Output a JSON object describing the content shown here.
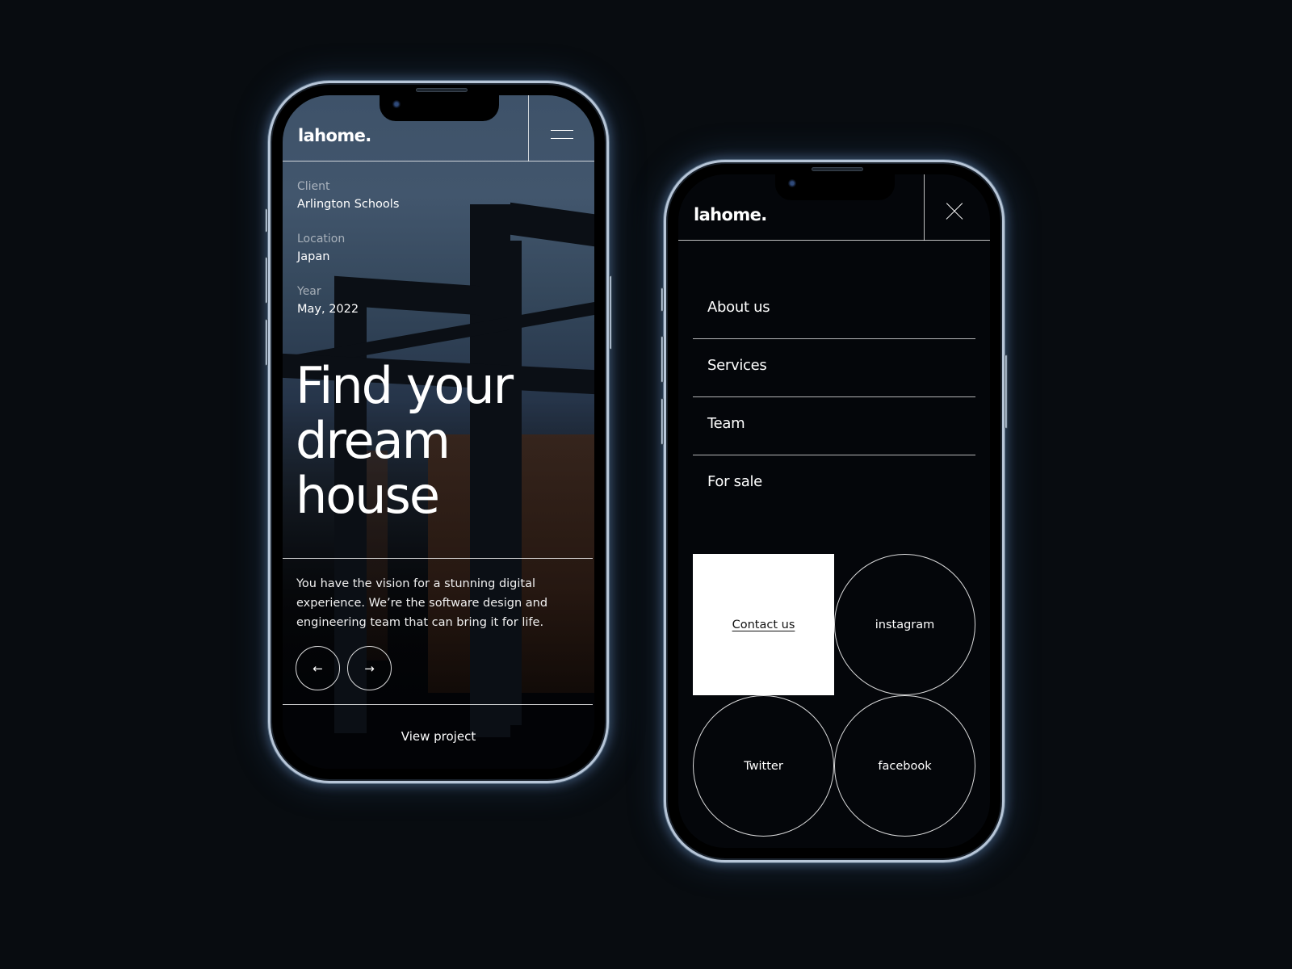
{
  "left_phone": {
    "brand": "lahome.",
    "menu_icon": "hamburger-menu-icon",
    "meta": [
      {
        "label": "Client",
        "value": "Arlington Schools"
      },
      {
        "label": "Location",
        "value": "Japan"
      },
      {
        "label": "Year",
        "value": "May, 2022"
      }
    ],
    "headline": [
      "Find your",
      "dream",
      "house"
    ],
    "description": "You have the vision for a stunning digital experience. We’re the software design and engineering team that can bring it for life.",
    "prev_icon": "←",
    "next_icon": "→",
    "cta": "View project"
  },
  "right_phone": {
    "brand": "lahome.",
    "close_icon": "close-icon",
    "nav": [
      {
        "label": "About us"
      },
      {
        "label": "Services"
      },
      {
        "label": "Team"
      },
      {
        "label": "For sale"
      }
    ],
    "tiles": {
      "contact": "Contact us",
      "instagram": "instagram",
      "twitter": "Twitter",
      "facebook": "facebook"
    }
  },
  "colors": {
    "background": "#080c10",
    "frame": "#b7c6d8",
    "accent_text": "#ffffff",
    "contact_tile": "#ffffff"
  }
}
